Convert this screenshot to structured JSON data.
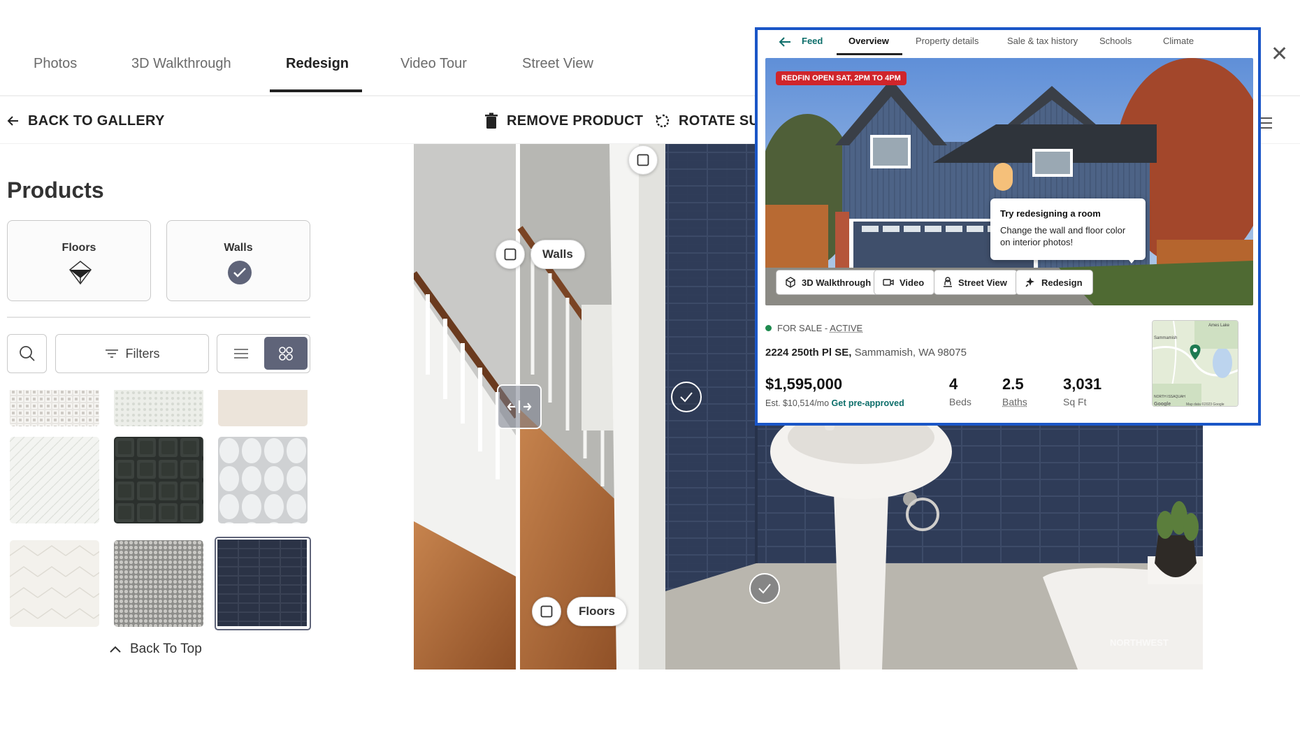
{
  "tabs": [
    {
      "label": "Photos"
    },
    {
      "label": "3D Walkthrough"
    },
    {
      "label": "Redesign"
    },
    {
      "label": "Video Tour"
    },
    {
      "label": "Street View"
    }
  ],
  "active_tab": "Redesign",
  "toolbar": {
    "back_label": "BACK TO GALLERY",
    "remove_label": "REMOVE PRODUCT",
    "rotate_label": "ROTATE SU"
  },
  "sidebar": {
    "title": "Products",
    "categories": [
      {
        "label": "Floors",
        "icon": "cube-outline-icon"
      },
      {
        "label": "Walls",
        "icon": "check-circle-icon"
      }
    ],
    "filters_label": "Filters",
    "back_to_top_label": "Back To Top"
  },
  "photo": {
    "walls_chip": "Walls",
    "floors_chip": "Floors",
    "watermark": "NORTHWEST"
  },
  "popup": {
    "tabs": [
      {
        "label": "Feed"
      },
      {
        "label": "Overview"
      },
      {
        "label": "Property details"
      },
      {
        "label": "Sale & tax history"
      },
      {
        "label": "Schools"
      },
      {
        "label": "Climate"
      }
    ],
    "open_badge": "REDFIN OPEN SAT, 2PM TO 4PM",
    "tooltip_title": "Try redesigning a room",
    "tooltip_body": "Change the wall and floor color on interior photos!",
    "media_buttons": [
      {
        "label": "3D Walkthrough",
        "icon": "cube-icon"
      },
      {
        "label": "Video",
        "icon": "video-camera-icon"
      },
      {
        "label": "Street View",
        "icon": "person-pin-icon"
      },
      {
        "label": "Redesign",
        "icon": "sparkle-icon"
      }
    ],
    "status_prefix": "FOR SALE -",
    "status_active": "ACTIVE",
    "address_street": "2224 250th Pl SE,",
    "address_city": "Sammamish, WA 98075",
    "price": "$1,595,000",
    "est_payment": "Est. $10,514/mo",
    "preapproved": "Get pre-approved",
    "stats": [
      {
        "value": "4",
        "label": "Beds"
      },
      {
        "value": "2.5",
        "label": "Baths"
      },
      {
        "value": "3,031",
        "label": "Sq Ft"
      }
    ],
    "map_labels": {
      "top": "Ames Lake",
      "left": "Sammamish",
      "bottom_left": "NORTH ISSAQUAH",
      "credit": "Map data ©2023 Google",
      "brand": "Google"
    }
  },
  "colors": {
    "accent_slate": "#5f6479",
    "popup_border": "#1a56c7",
    "redfin_red": "#d0252b",
    "redfin_teal": "#0c6e6a",
    "status_green": "#1e8a4e"
  }
}
